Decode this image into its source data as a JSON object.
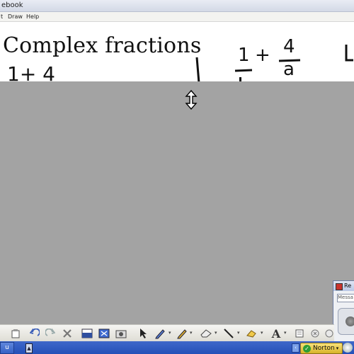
{
  "window": {
    "title": "ebook"
  },
  "menu": {
    "items": [
      "t",
      "Draw",
      "Help"
    ]
  },
  "canvas": {
    "heading": "Complex fractions",
    "eq_left": "1+ 4",
    "eq_right": {
      "term1": "1",
      "plus": "+",
      "numerator": "4",
      "denominator": "a"
    }
  },
  "toolbar": {
    "icons": [
      "paste-icon",
      "undo-icon",
      "redo-icon",
      "delete-icon",
      "screen-shade-icon",
      "fullscreen-icon",
      "capture-icon",
      "select-arrow-icon",
      "pen-icon",
      "creative-pen-icon",
      "eraser-icon",
      "line-icon",
      "shape-fill-icon",
      "text-icon",
      "properties-icon",
      "close-toolbar-icon"
    ]
  },
  "recorder": {
    "title": "Re",
    "field": "Messa"
  },
  "taskbar": {
    "left_text": "u",
    "norton_label": "Norton"
  },
  "colors": {
    "gray_area": "#a3a3a3",
    "taskbar": "#2f5cc4",
    "norton": "#f1d14f"
  }
}
